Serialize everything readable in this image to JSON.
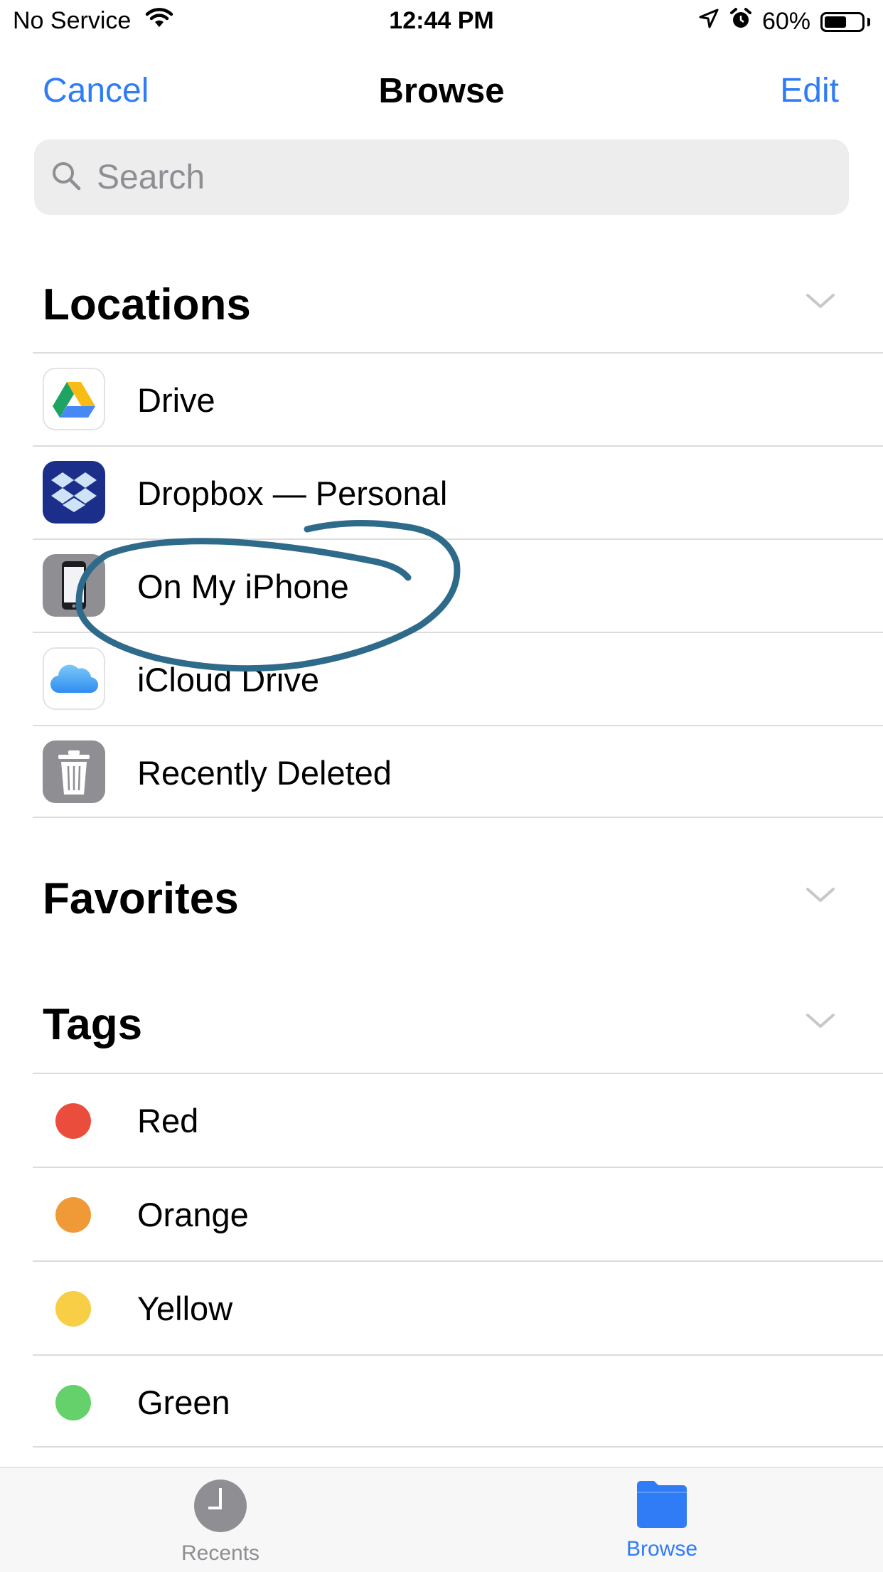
{
  "status_bar": {
    "carrier": "No Service",
    "time": "12:44 PM",
    "battery": "60%",
    "battery_level": 0.6
  },
  "nav": {
    "cancel": "Cancel",
    "title": "Browse",
    "edit": "Edit"
  },
  "search": {
    "placeholder": "Search"
  },
  "sections": {
    "locations": "Locations",
    "favorites": "Favorites",
    "tags": "Tags"
  },
  "locations": [
    {
      "label": "Drive",
      "icon": "google-drive-icon"
    },
    {
      "label": "Dropbox — Personal",
      "icon": "dropbox-icon"
    },
    {
      "label": "On My iPhone",
      "icon": "iphone-icon"
    },
    {
      "label": "iCloud Drive",
      "icon": "icloud-icon"
    },
    {
      "label": "Recently Deleted",
      "icon": "trash-icon"
    }
  ],
  "tags": [
    {
      "label": "Red",
      "color": "#EB4D3D"
    },
    {
      "label": "Orange",
      "color": "#F09A37"
    },
    {
      "label": "Yellow",
      "color": "#F8CE46"
    },
    {
      "label": "Green",
      "color": "#65D16A"
    }
  ],
  "tabs": {
    "recents": "Recents",
    "browse": "Browse"
  },
  "colors": {
    "accent": "#2F7CF6",
    "annotation": "#2E6A8A"
  }
}
